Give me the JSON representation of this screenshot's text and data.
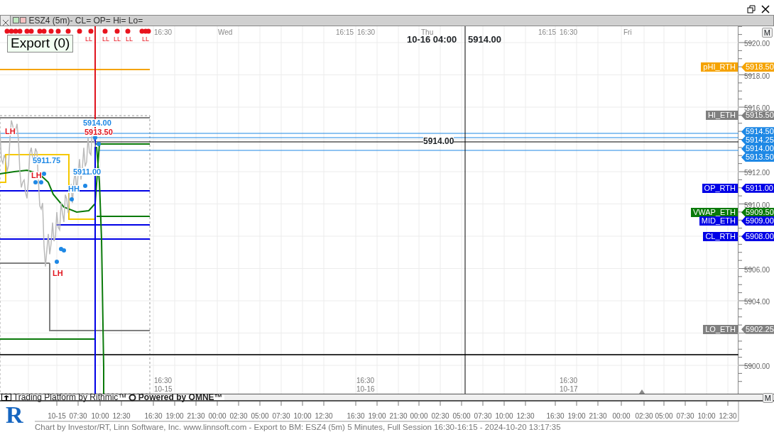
{
  "window": {
    "title": "ESZ4 (5m)- CL= OP= Hi= Lo="
  },
  "export_button": "Export (0)",
  "top_time_labels": [
    "16:30",
    "Wed",
    "16:15",
    "16:30",
    "Thu",
    "16:15",
    "16:30",
    "Fri"
  ],
  "crosshair": {
    "time": "10-16 04:00",
    "price": "5914.00",
    "line_price": "5914.00"
  },
  "top_markers": [
    "LL",
    "LL",
    "LL",
    "LL",
    "LL"
  ],
  "swing_labels": [
    {
      "text": "5914.00",
      "color": "#1e88e5"
    },
    {
      "text": "5913.50",
      "color": "#e0141e"
    },
    {
      "text": "LH",
      "color": "#e0141e"
    },
    {
      "text": "5911.75",
      "color": "#1e88e5"
    },
    {
      "text": "LH",
      "color": "#e0141e"
    },
    {
      "text": "5911.00",
      "color": "#1e88e5"
    },
    {
      "text": "HH",
      "color": "#1e88e5"
    },
    {
      "text": "LH",
      "color": "#e0141e"
    }
  ],
  "session_labels": [
    {
      "time": "16:30",
      "date": "10-15"
    },
    {
      "time": "16:30",
      "date": "10-16"
    },
    {
      "time": "16:30",
      "date": "10-17"
    }
  ],
  "price_axis": {
    "button": "M",
    "ticks": [
      "5920.00",
      "5918.00",
      "5916.00",
      "5912.00",
      "5910.00",
      "5906.00",
      "5904.00",
      "5900.00"
    ],
    "levels": [
      {
        "label": "pHI_RTH",
        "price": "5918.50",
        "color": "#f5a300"
      },
      {
        "label": "HI_ETH",
        "price": "5915.50",
        "color": "#808080"
      },
      {
        "price": "5914.50",
        "color": "#1e88e5"
      },
      {
        "price": "5914.25",
        "color": "#1e88e5"
      },
      {
        "price": "5914.00",
        "color": "#1e88e5"
      },
      {
        "price": "5913.50",
        "color": "#1e88e5"
      },
      {
        "label": "OP_RTH",
        "price": "5911.00",
        "color": "#0000e6"
      },
      {
        "label": "VWAP_ETH",
        "price": "5909.50",
        "color": "#0a7a0a"
      },
      {
        "label": "MID_ETH",
        "price": "5909.00",
        "color": "#0000e6"
      },
      {
        "label": "CL_RTH",
        "price": "5908.00",
        "color": "#0000e6"
      },
      {
        "label": "LO_ETH",
        "price": "5902.25",
        "color": "#808080"
      }
    ]
  },
  "scroll_bar": {
    "left_text": "Trading Platform by Rithmic™",
    "right_text": "Powered by OMNE™",
    "button": "M"
  },
  "time_axis": [
    "10-15",
    "07:30",
    "10:00",
    "12:30",
    "16:30",
    "19:00",
    "21:30",
    "00:00",
    "02:30",
    "05:00",
    "07:30",
    "10:00",
    "12:30",
    "16:30",
    "19:00",
    "21:30",
    "00:00",
    "02:30",
    "05:00",
    "07:30",
    "10:00",
    "12:30",
    "16:30",
    "19:00",
    "21:30",
    "00:00",
    "02:30",
    "05:00",
    "07:30",
    "10:00",
    "12:30"
  ],
  "logo": "R",
  "footer": "Chart by Investor/RT, Linn Software, Inc. www.linnsoft.com - Export to BM: ESZ4 (5m) 5 Minutes, Full Session 16:30-16:15 - 2024-10-20 13:17:35"
}
